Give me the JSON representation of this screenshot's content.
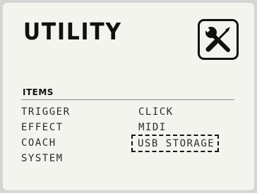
{
  "header": {
    "title": "UTILITY",
    "icon": "tools-icon"
  },
  "items_section": {
    "label": "ITEMS"
  },
  "menu": {
    "column_left": [
      "TRIGGER",
      "EFFECT",
      "COACH",
      "SYSTEM"
    ],
    "column_right": [
      "CLICK",
      "MIDI",
      "USB STORAGE"
    ],
    "selected_item": "USB STORAGE"
  },
  "colors": {
    "screen_background": "#f4f4ef",
    "text": "#111111",
    "frame": "#d5d5d5"
  }
}
